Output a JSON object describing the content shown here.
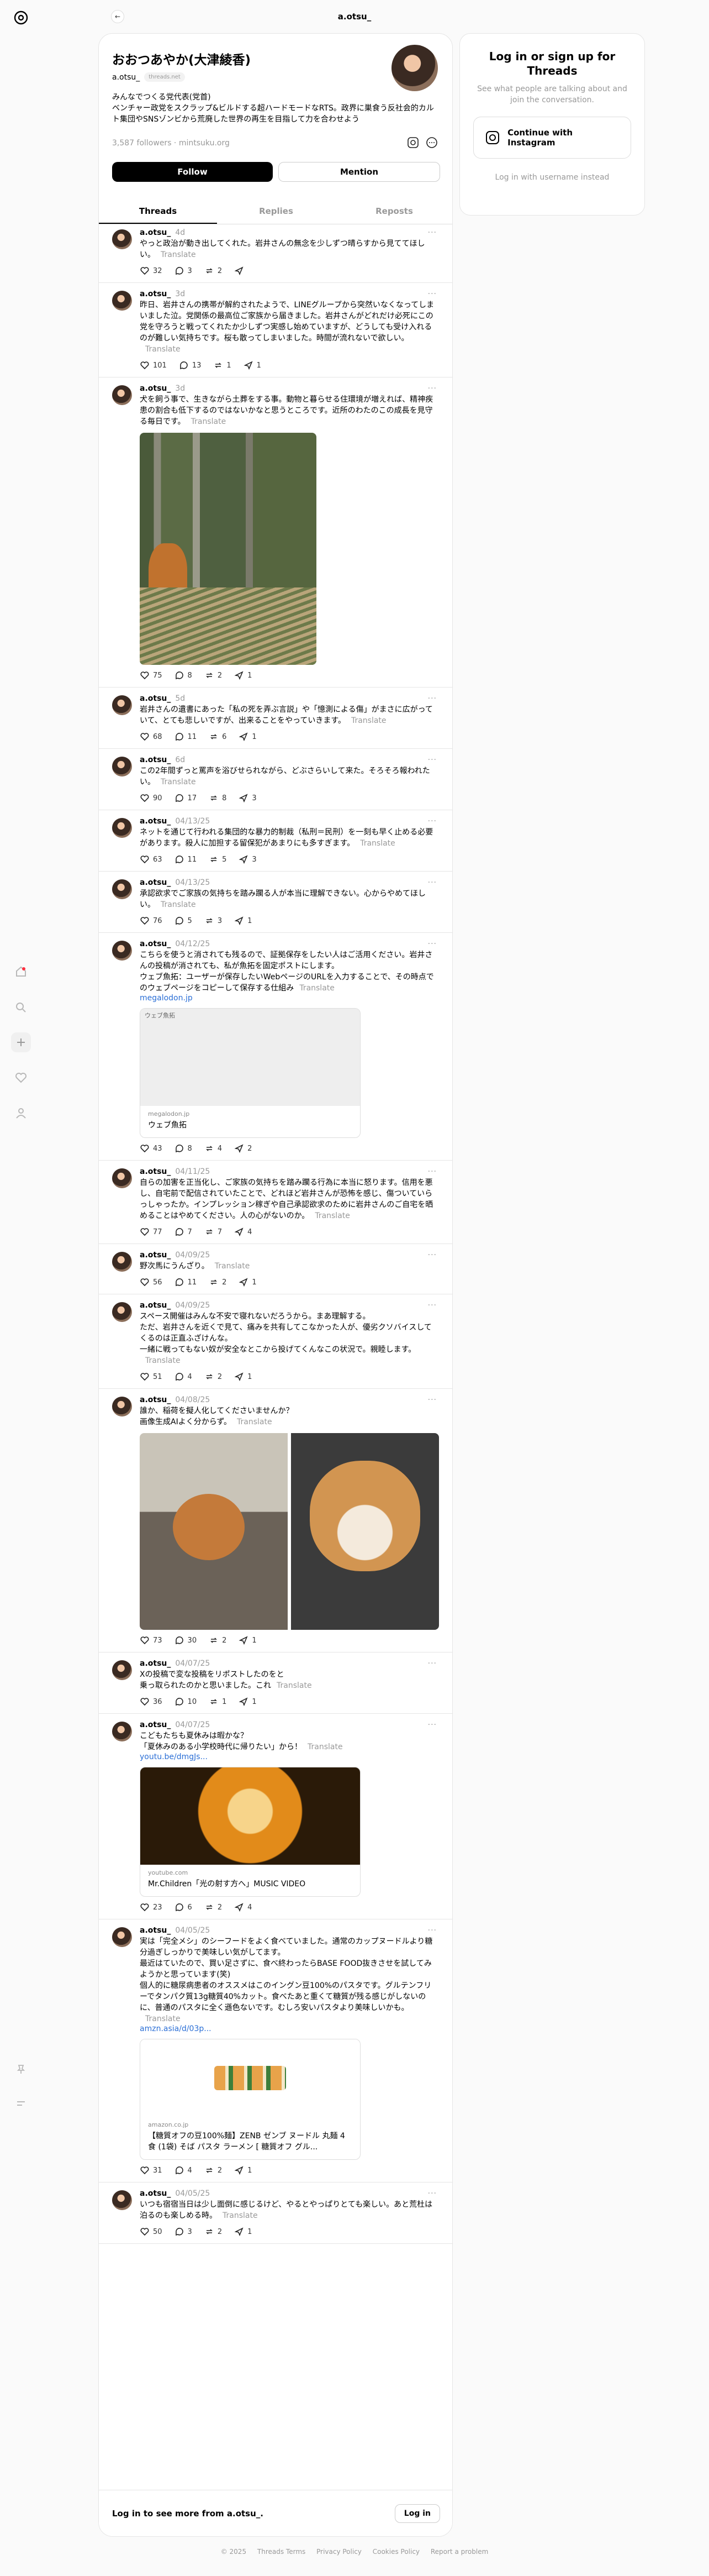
{
  "top": {
    "title": "a.otsu_"
  },
  "profile": {
    "name": "おおつあやか(大津綾香)",
    "handle": "a.otsu_",
    "chip": "threads.net",
    "bio_lines": [
      "みんなでつくる党代表(党首)",
      "ベンチャー政党をスクラップ&ビルドする超ハードモードなRTS。政界に巣食う反社会的カルト集団やSNSゾンビから荒廃した世界の再生を目指して力を合わせよう"
    ],
    "followers": "3,587 followers · mintsuku.org",
    "follow_label": "Follow",
    "mention_label": "Mention"
  },
  "tabs": [
    "Threads",
    "Replies",
    "Reposts"
  ],
  "translate": "Translate",
  "posts": [
    {
      "time": "4d",
      "text": "やっと政治が動き出してくれた。岩井さんの無念を少しずつ晴らすから見ててほしい。",
      "likes": "32",
      "replies": "3",
      "reposts": "2",
      "shares": "",
      "media": "none"
    },
    {
      "time": "3d",
      "text": "昨日、岩井さんの携帯が解約されたようで、LINEグループから突然いなくなってしまいました泣。党関係の最高位ご家族から届きました。岩井さんがどれだけ必死にこの党を守ろうと戦ってくれたか少しずつ実感し始めていますが、どうしても受け入れるのが難しい気持ちです。桜も散ってしまいました。時間が流れないで欲しい。",
      "likes": "101",
      "replies": "13",
      "reposts": "1",
      "shares": "1",
      "media": "none"
    },
    {
      "time": "3d",
      "text": "犬を飼う事で、生きながら土葬をする事。動物と暮らせる住環境が増えれば、精神疾患の割合も低下するのではないかなと思うところです。近所のわたのこの成長を見守る毎日です。",
      "likes": "75",
      "replies": "8",
      "reposts": "2",
      "shares": "1",
      "media": "dogphoto"
    },
    {
      "time": "5d",
      "text": "岩井さんの遺書にあった「私の死を弄ぶ言説」や「憶測による傷」がまさに広がっていて、とても悲しいですが、出来ることをやっていきます。",
      "likes": "68",
      "replies": "11",
      "reposts": "6",
      "shares": "1",
      "media": "none"
    },
    {
      "time": "6d",
      "text": "この2年間ずっと罵声を浴びせられながら、どぶさらいして来た。そろそろ報われたい。",
      "likes": "90",
      "replies": "17",
      "reposts": "8",
      "shares": "3",
      "media": "none"
    },
    {
      "time": "04/13/25",
      "text": "ネットを通じて行われる集団的な暴力的制裁（私刑＝民刑）を一刻も早く止める必要があります。殺人に加担する留保犯があまりにも多すぎます。",
      "likes": "63",
      "replies": "11",
      "reposts": "5",
      "shares": "3",
      "media": "none"
    },
    {
      "time": "04/13/25",
      "text": "承認欲求でご家族の気持ちを踏み躙る人が本当に理解できない。心からやめてほしい。",
      "likes": "76",
      "replies": "5",
      "reposts": "3",
      "shares": "1",
      "media": "none"
    },
    {
      "time": "04/12/25",
      "text": "こちらを使うと消されても残るので、証拠保存をしたい人はご活用ください。岩井さんの投稿が消されても、私が魚拓を固定ポストにします。\nウェブ魚拓：ユーザーが保存したいWebページのURLを入力することで、その時点でのウェブページをコピーして保存する仕組み",
      "link": "megalodon.jp",
      "likes": "43",
      "replies": "8",
      "reposts": "4",
      "shares": "2",
      "media": "card1",
      "card_alt": "ウェブ魚拓",
      "card_domain": "megalodon.jp",
      "card_title": "ウェブ魚拓"
    },
    {
      "time": "04/11/25",
      "text": "自らの加害を正当化し、ご家族の気持ちを踏み躙る行為に本当に怒ります。信用を悪し、自宅前で配信されていたことで、どれほど岩井さんが恐怖を感じ、傷ついていらっしゃったか。インプレッション稼ぎや自己承認欲求のために岩井さんのご自宅を晒めることはやめてください。人の心がないのか。",
      "likes": "77",
      "replies": "7",
      "reposts": "7",
      "shares": "4",
      "media": "none"
    },
    {
      "time": "04/09/25",
      "text": "野次馬にうんざり。",
      "likes": "56",
      "replies": "11",
      "reposts": "2",
      "shares": "1",
      "media": "none"
    },
    {
      "time": "04/09/25",
      "text": "スペース開催はみんな不安で寝れないだろうから。まあ理解する。\nただ、岩井さんを近くで見て、痛みを共有してこなかった人が、優劣クソバイスしてくるのは正直ふざけんな。\n一緒に戦ってもない奴が安全なとこから投げてくんなこの状況で。親睦します。",
      "likes": "51",
      "replies": "4",
      "reposts": "2",
      "shares": "1",
      "media": "none"
    },
    {
      "time": "04/08/25",
      "text": "誰か、稲荷を擬人化してくださいませんか？\n画像生成AIよく分からず。",
      "likes": "73",
      "replies": "30",
      "reposts": "2",
      "shares": "1",
      "media": "shiba"
    },
    {
      "time": "04/07/25",
      "text": "Xの投稿で変な投稿をリポストしたのをと\n乗っ取られたのかと思いました。これ",
      "likes": "36",
      "replies": "10",
      "reposts": "1",
      "shares": "1",
      "media": "none"
    },
    {
      "time": "04/07/25",
      "text": "こどもたちも夏休みは暇かな？\n「夏休みのある小学校時代に帰りたい」から！",
      "link": "youtu.be/dmgJs...",
      "likes": "23",
      "replies": "6",
      "reposts": "2",
      "shares": "4",
      "media": "video",
      "card_domain": "youtube.com",
      "card_title": "Mr.Children「光の射す方へ」MUSIC VIDEO"
    },
    {
      "time": "04/05/25",
      "text": "実は「完全メシ」のシーフードをよく食べていました。通常のカップヌードルより糖分過ぎしっかりで美味しい気がしてます。\n最近はていたので、買い足さずに、食べ終わったらBASE FOOD抜きさせを試してみようかと思っています(笑)\n個人的に糖尿病患者のオススメはこのイングン豆100%のパスタです。グルテンフリーでタンパク質13g糖質40%カット。食べたあと重くて糖質が残る感じがしないのに、普通のパスタに全く遜色ないです。むしろ安いパスタより美味しいかも。",
      "link": "amzn.asia/d/03p...",
      "likes": "31",
      "replies": "4",
      "reposts": "2",
      "shares": "1",
      "media": "card2",
      "card_domain": "amazon.co.jp",
      "card_title": "【糖質オフの豆100%麺】ZENB ゼンブ ヌードル 丸麺 4食 (1袋) そば パスタ ラーメン [ 糖質オフ グル..."
    },
    {
      "time": "04/05/25",
      "text": "いつも宿宿当日は少し面倒に感じるけど、やるとやっぱりとても楽しい。あと荒杜は泊るのも楽しめる時。",
      "likes": "50",
      "replies": "3",
      "reposts": "2",
      "shares": "1",
      "media": "none"
    }
  ],
  "bottom": {
    "text": "Log in to see more from a.otsu_.",
    "login": "Log in"
  },
  "login": {
    "title": "Log in or sign up for Threads",
    "sub": "See what people are talking about and join the conversation.",
    "ig": "Continue with Instagram",
    "usr": "Log in with username instead"
  },
  "footer": [
    "© 2025",
    "Threads Terms",
    "Privacy Policy",
    "Cookies Policy",
    "Report a problem"
  ]
}
